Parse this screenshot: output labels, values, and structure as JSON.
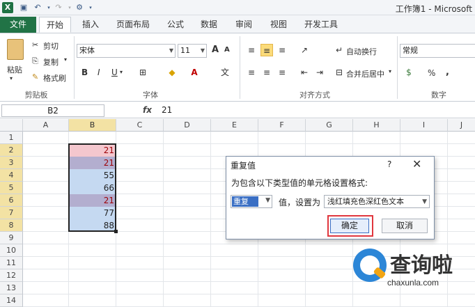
{
  "window": {
    "title": "工作簿1 - Microsoft"
  },
  "tabs": [
    "文件",
    "开始",
    "插入",
    "页面布局",
    "公式",
    "数据",
    "审阅",
    "视图",
    "开发工具"
  ],
  "ribbon": {
    "clipboard": {
      "paste": "粘贴",
      "cut": "剪切",
      "copy": "复制",
      "format_painter": "格式刷",
      "label": "剪贴板"
    },
    "font": {
      "name": "宋体",
      "size": "11",
      "grow": "A",
      "shrink": "A",
      "bold": "B",
      "italic": "I",
      "underline": "U",
      "label": "字体"
    },
    "alignment": {
      "wrap_text": "自动换行",
      "merge_center": "合并后居中",
      "label": "对齐方式"
    },
    "number": {
      "format": "常规",
      "percent": "%",
      "comma": ",",
      "label": "数字"
    }
  },
  "formula_bar": {
    "name_box": "B2",
    "fx": "fx",
    "value": "21"
  },
  "sheet": {
    "columns": [
      "A",
      "B",
      "C",
      "D",
      "E",
      "F",
      "G",
      "H",
      "I",
      "J"
    ],
    "rows": [
      "1",
      "2",
      "3",
      "4",
      "5",
      "6",
      "7",
      "8",
      "9",
      "10",
      "11",
      "12",
      "13",
      "14"
    ],
    "selected_col": "B",
    "b_values": [
      "21",
      "21",
      "55",
      "66",
      "21",
      "77",
      "88"
    ],
    "b_duplicate": [
      true,
      true,
      false,
      false,
      true,
      false,
      false
    ],
    "colors": {
      "dup_fill": "#f4c7ce",
      "dup_text": "#9c0006",
      "sel_fill": "#c5d9f1",
      "overlap_fill": "#b3aecf"
    }
  },
  "dialog": {
    "title": "重复值",
    "help": "?",
    "close": "✕",
    "description": "为包含以下类型值的单元格设置格式:",
    "type_value": "重复",
    "middle_text": "值，设置为",
    "format_value": "浅红填充色深红色文本",
    "ok": "确定",
    "cancel": "取消"
  },
  "watermark": {
    "cn": "查询啦",
    "en": "chaxunla.com"
  }
}
